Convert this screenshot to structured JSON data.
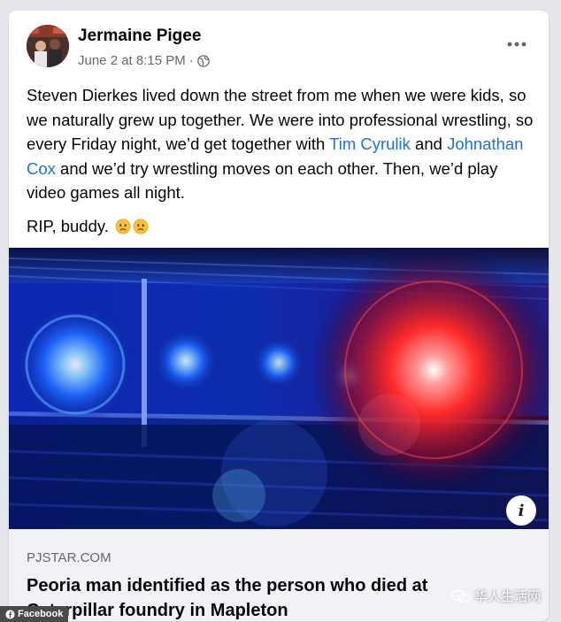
{
  "post": {
    "author": "Jermaine Pigee",
    "date": "June 2 at 8:15 PM",
    "separator": "·",
    "audience_icon": "globe-icon",
    "more_icon": "ellipsis-icon",
    "text_part1": "Steven Dierkes lived down the street from me when we were kids, so we naturally grew up together. We were into professional wrestling, so every Friday night, we’d get together with ",
    "mention1": "Tim Cyrulik",
    "text_part2": " and ",
    "mention2": "Johnathan Cox",
    "text_part3": " and we’d try wrestling moves on each other. Then, we’d play video games all night.",
    "rip_text": "RIP, buddy.",
    "emoji_icons": [
      "frowning-face-icon",
      "frowning-face-icon"
    ]
  },
  "link_preview": {
    "domain": "PJSTAR.COM",
    "title": "Peoria man identified as the person who died at Caterpillar foundry in Mapleton",
    "info_icon": "i"
  },
  "watermarks": {
    "facebook": "Facebook",
    "chinese": "华人生活网"
  },
  "colors": {
    "link": "#216fdb",
    "text": "#050505",
    "secondary": "#65676b",
    "preview_bg": "#f0f2f5",
    "police_blue": "#1a3cff",
    "police_red": "#ff2020"
  }
}
